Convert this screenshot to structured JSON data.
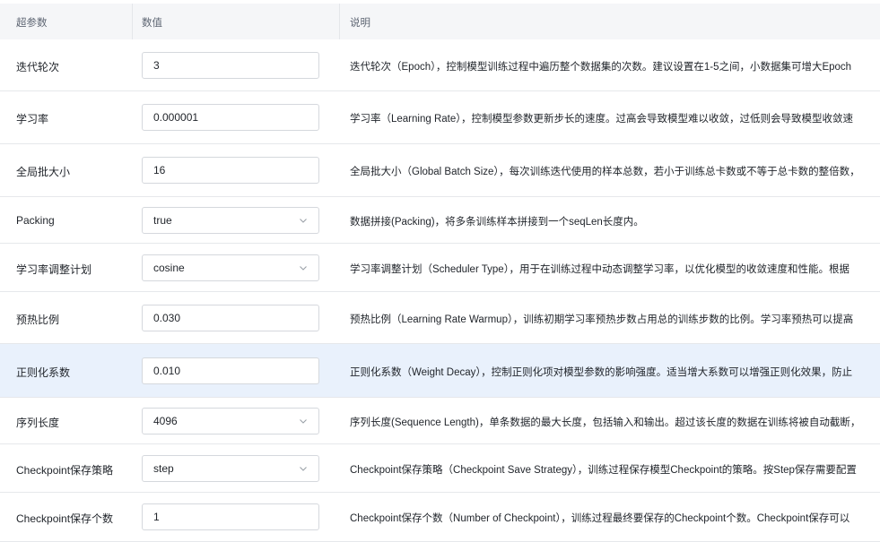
{
  "header": {
    "param": "超参数",
    "value": "数值",
    "desc": "说明"
  },
  "rows": [
    {
      "name": "迭代轮次",
      "type": "input",
      "value": "3",
      "desc": "迭代轮次（Epoch），控制模型训练过程中遍历整个数据集的次数。建议设置在1-5之间，小数据集可增大Epoch"
    },
    {
      "name": "学习率",
      "type": "input",
      "value": "0.000001",
      "desc": "学习率（Learning Rate），控制模型参数更新步长的速度。过高会导致模型难以收敛，过低则会导致模型收敛速"
    },
    {
      "name": "全局批大小",
      "type": "input",
      "value": "16",
      "desc": "全局批大小（Global Batch Size），每次训练迭代使用的样本总数，若小于训练总卡数或不等于总卡数的整倍数，"
    },
    {
      "name": "Packing",
      "type": "select",
      "value": "true",
      "desc": "数据拼接(Packing)，将多条训练样本拼接到一个seqLen长度内。"
    },
    {
      "name": "学习率调整计划",
      "type": "select",
      "value": "cosine",
      "desc": "学习率调整计划（Scheduler Type），用于在训练过程中动态调整学习率，以优化模型的收敛速度和性能。根据"
    },
    {
      "name": "预热比例",
      "type": "input",
      "value": "0.030",
      "desc": "预热比例（Learning Rate Warmup），训练初期学习率预热步数占用总的训练步数的比例。学习率预热可以提高"
    },
    {
      "name": "正则化系数",
      "type": "input",
      "value": "0.010",
      "desc": "正则化系数（Weight Decay），控制正则化项对模型参数的影响强度。适当增大系数可以增强正则化效果，防止"
    },
    {
      "name": "序列长度",
      "type": "select",
      "value": "4096",
      "desc": "序列长度(Sequence Length)，单条数据的最大长度，包括输入和输出。超过该长度的数据在训练将被自动截断，"
    },
    {
      "name": "Checkpoint保存策略",
      "type": "select",
      "value": "step",
      "desc": "Checkpoint保存策略（Checkpoint Save Strategy），训练过程保存模型Checkpoint的策略。按Step保存需要配置"
    },
    {
      "name": "Checkpoint保存个数",
      "type": "input",
      "value": "1",
      "desc": "Checkpoint保存个数（Number of Checkpoint），训练过程最终要保存的Checkpoint个数。Checkpoint保存可以"
    }
  ]
}
